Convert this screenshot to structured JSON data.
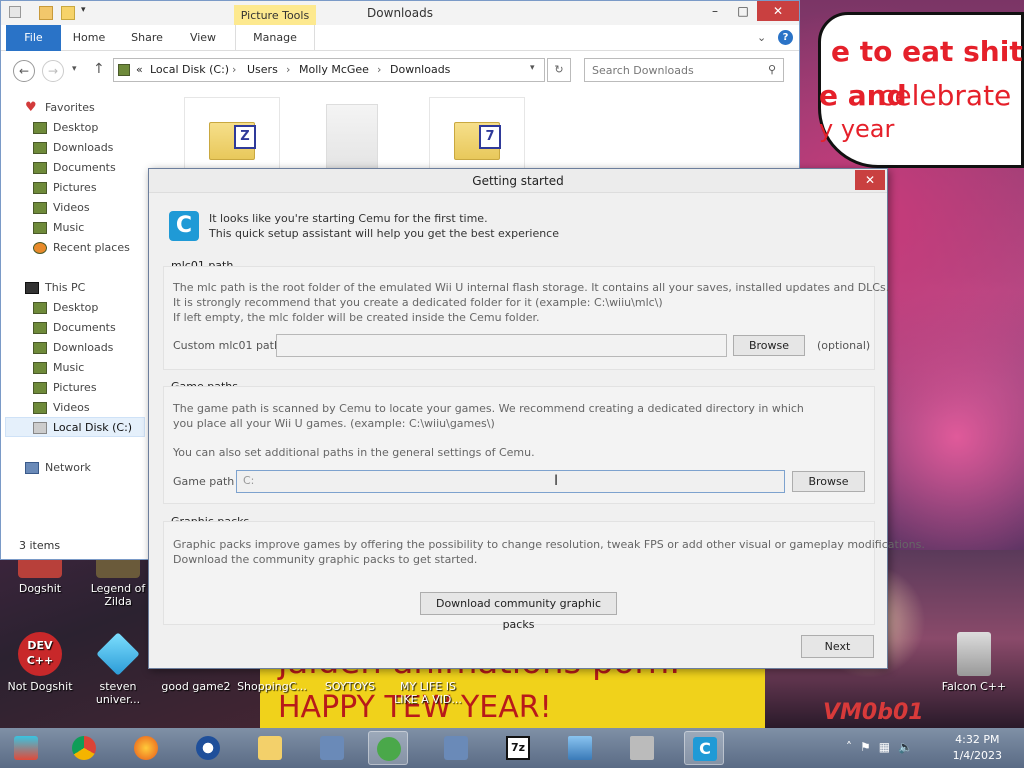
{
  "explorer": {
    "title": "Downloads",
    "context_tab": "Picture Tools",
    "tabs": [
      "File",
      "Home",
      "Share",
      "View",
      "Manage"
    ],
    "address": {
      "prefix": "«",
      "crumbs": [
        "Local Disk (C:)",
        "Users",
        "Molly McGee",
        "Downloads"
      ]
    },
    "search_placeholder": "Search Downloads",
    "nav": {
      "favorites_label": "Favorites",
      "favorites": [
        "Desktop",
        "Downloads",
        "Documents",
        "Pictures",
        "Videos",
        "Music",
        "Recent places"
      ],
      "thispc_label": "This PC",
      "thispc": [
        "Desktop",
        "Documents",
        "Downloads",
        "Music",
        "Pictures",
        "Videos",
        "Local Disk (C:)"
      ],
      "network_label": "Network"
    },
    "status": "3 items",
    "files": [
      {
        "badge": "Z"
      },
      {
        "badge": ""
      },
      {
        "badge": "7"
      }
    ]
  },
  "dialog": {
    "title": "Getting started",
    "intro_line1": "It looks like you're starting Cemu for the first time.",
    "intro_line2": "This quick setup assistant will help you get the best experience",
    "mlc": {
      "label": "mlc01 path",
      "text1": "The mlc path is the root folder of the emulated Wii U internal flash storage. It contains all your saves, installed updates and DLCs.",
      "text2": "It is strongly recommend that you create a dedicated folder for it (example: C:\\wiiu\\mlc\\)",
      "text3": "If left empty, the mlc folder will be created inside the Cemu folder.",
      "field_label": "Custom mlc01 path",
      "field_value": "",
      "browse": "Browse",
      "optional": "(optional)"
    },
    "game": {
      "label": "Game paths",
      "text1": "The game path is scanned by Cemu to locate your games. We recommend creating a dedicated directory in which",
      "text2": "you place all your Wii U games. (example: C:\\wiiu\\games\\)",
      "text3": "You can also set additional paths in the general settings of Cemu.",
      "field_label": "Game path",
      "field_value": "C:",
      "browse": "Browse"
    },
    "packs": {
      "label": "Graphic packs",
      "text1": "Graphic packs improve games by offering the possibility to change resolution, tweak FPS or add other visual or gameplay modifications.",
      "text2": "Download the community graphic packs to get started.",
      "button": "Download community graphic packs"
    },
    "next": "Next"
  },
  "desktop": {
    "meme_top": [
      "e to eat shit",
      "e and",
      "celebrate",
      "y year"
    ],
    "meme_bottom": [
      "jaiden animations porn.",
      "HAPPY TEW YEAR!",
      "VM0b01"
    ],
    "icons_row1": [
      "Dogshit",
      "Legend of Zilda"
    ],
    "icons_row2": [
      "Not Dogshit",
      "steven univer...",
      "good game2",
      "ShoppingC...",
      "SOYTOYS",
      "MY LIFE IS LIKE A VID...",
      "Falcon C++"
    ],
    "dev_label": "DEV C++"
  },
  "taskbar": {
    "time": "4:32 PM",
    "date": "1/4/2023"
  }
}
